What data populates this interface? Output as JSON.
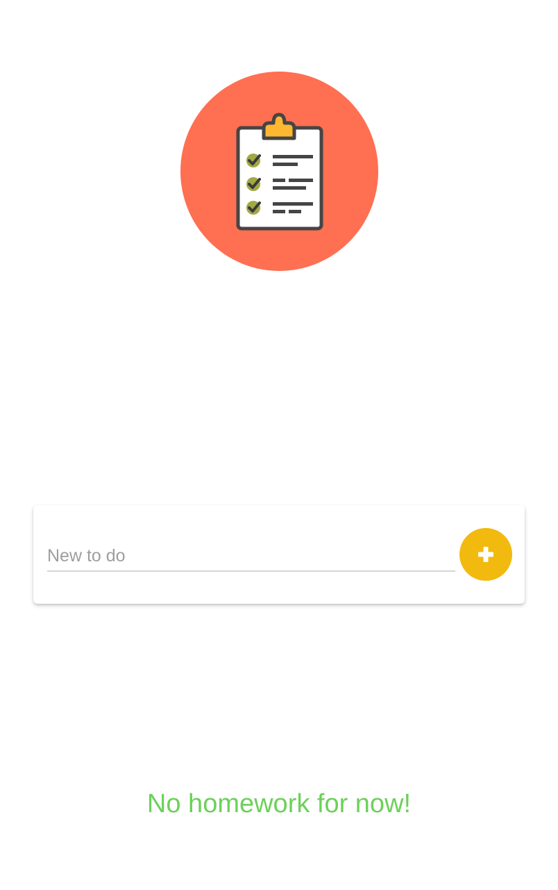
{
  "app": {
    "logo_icon": "clipboard-checklist-icon",
    "logo_background_color": "#ff6f52"
  },
  "todo_form": {
    "input_value": "",
    "input_placeholder": "New to do",
    "add_button_icon": "plus-icon",
    "add_button_color": "#f2b90f"
  },
  "empty_state": {
    "message": "No homework for now!",
    "color": "#6dd05a"
  }
}
